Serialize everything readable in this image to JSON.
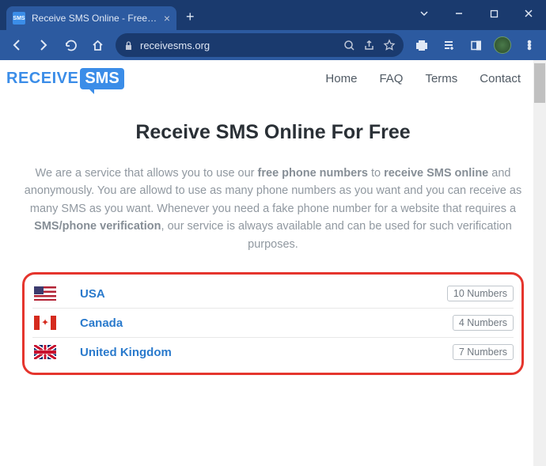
{
  "browser": {
    "tab_title": "Receive SMS Online - Free Temp",
    "tab_favicon_text": "SMS",
    "url": "receivesms.org"
  },
  "logo": {
    "part1": "RECEIVE",
    "part2": "SMS"
  },
  "nav": {
    "home": "Home",
    "faq": "FAQ",
    "terms": "Terms",
    "contact": "Contact"
  },
  "hero": {
    "title": "Receive SMS Online For Free",
    "desc_pre": "We are a service that allows you to use our ",
    "desc_b1": "free phone numbers",
    "desc_mid1": " to ",
    "desc_b2": "receive SMS online",
    "desc_mid2": " and anonymously. You are allowd to use as many phone numbers as you want and you can receive as many SMS as you want. Whenever you need a fake phone number for a website that requires a ",
    "desc_b3": "SMS/phone verification",
    "desc_post": ", our service is always available and can be used for such verification purposes."
  },
  "countries": [
    {
      "name": "USA",
      "count": "10 Numbers",
      "flag": "us"
    },
    {
      "name": "Canada",
      "count": "4 Numbers",
      "flag": "ca"
    },
    {
      "name": "United Kingdom",
      "count": "7 Numbers",
      "flag": "uk"
    }
  ]
}
